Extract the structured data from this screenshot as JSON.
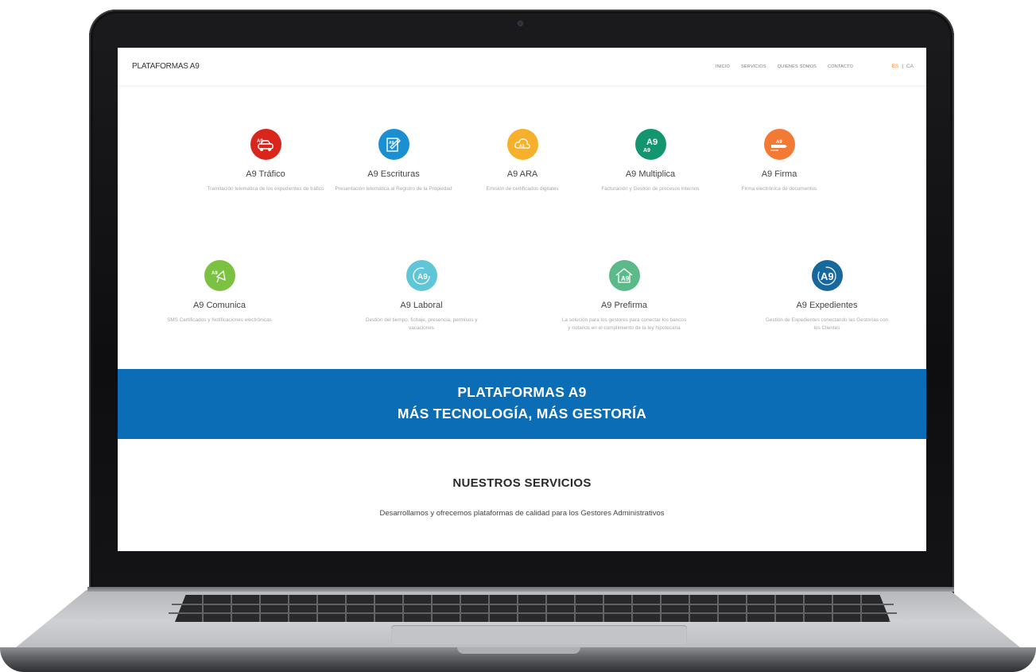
{
  "nav": {
    "brand": "PLATAFORMAS A9",
    "links": [
      "INICIO",
      "SERVICIOS",
      "QUIÉNES SOMOS",
      "CONTACTO"
    ],
    "lang_es": "ES",
    "lang_sep": "|",
    "lang_ca": "CA"
  },
  "services": [
    {
      "title": "A9 Tráfico",
      "desc": "Tramitación telemática de los expedientes de tráfico",
      "color": "#d9261c",
      "icon": "car-icon",
      "badge": "A9"
    },
    {
      "title": "A9 Escrituras",
      "desc": "Presentación telemática al Registro de la Propiedad",
      "color": "#1a8fd1",
      "icon": "document-pen-icon",
      "badge": "A9"
    },
    {
      "title": "A9 ARA",
      "desc": "Emisión de certificados digitales",
      "color": "#f6b02c",
      "icon": "cloud-certificate-icon",
      "badge": "A9"
    },
    {
      "title": "A9 Multiplica",
      "desc": "Facturación y Gestión de procesos internos",
      "color": "#13956f",
      "icon": "multiply-icon",
      "badge": "A9"
    },
    {
      "title": "A9 Firma",
      "desc": "Firma electrónica de documentos",
      "color": "#f27a35",
      "icon": "pen-signature-icon",
      "badge": "A9"
    },
    {
      "title": "A9 Comunica",
      "desc": "SMS Certificados y Notificaciones electrónicas",
      "color": "#7cc242",
      "icon": "megaphone-icon",
      "badge": "A9"
    },
    {
      "title": "A9 Laboral",
      "desc": "Gestión del tiempo, fichaje, presencia, permisos y vacaciones",
      "color": "#5ec6d6",
      "icon": "clock-icon",
      "badge": "A9"
    },
    {
      "title": "A9 Prefirma",
      "desc": "La solución para los gestores para conectar los bancos y notarios en el cumplimiento de la ley hipotecaria",
      "color": "#5cb98a",
      "icon": "house-icon",
      "badge": "A9"
    },
    {
      "title": "A9 Expedientes",
      "desc": "Gestión de Expedientes conectando las Gestorías con los Clientes",
      "color": "#17689c",
      "icon": "folder-icon",
      "badge": "A9"
    }
  ],
  "banner": {
    "line1": "PLATAFORMAS A9",
    "line2": "MÁS TECNOLOGÍA, MÁS GESTORÍA",
    "color": "#0a6db5"
  },
  "section": {
    "heading": "NUESTROS SERVICIOS",
    "subheading": "Desarrollamos y ofrecemos plataformas de calidad para los Gestores Administrativos"
  }
}
